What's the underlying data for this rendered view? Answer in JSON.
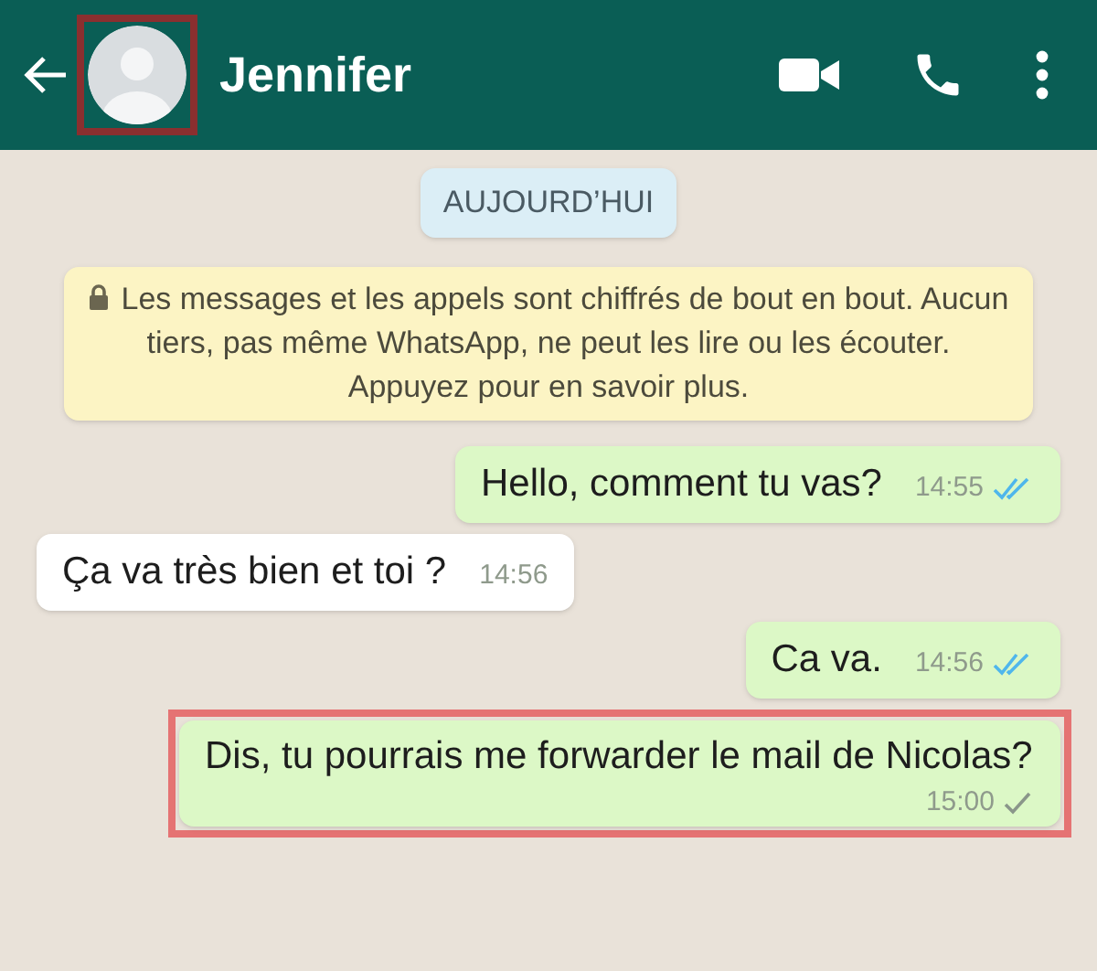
{
  "header": {
    "contact_name": "Jennifer",
    "avatar_highlighted": true
  },
  "date_chip": "AUJOURD’HUI",
  "notice": "Les messages et les appels sont chiffrés de bout en bout. Aucun tiers, pas même WhatsApp, ne peut les lire ou les écouter. Appuyez pour en savoir plus.",
  "messages": [
    {
      "outgoing": true,
      "text": "Hello, comment tu vas?",
      "time": "14:55",
      "read": true,
      "highlighted": false
    },
    {
      "outgoing": false,
      "text": "Ça va très bien et toi ?",
      "time": "14:56",
      "highlighted": false
    },
    {
      "outgoing": true,
      "text": "Ca va.",
      "time": "14:56",
      "read": true,
      "highlighted": false
    },
    {
      "outgoing": true,
      "text": "Dis, tu pourrais me forwarder le mail de Nicolas?",
      "time": "15:00",
      "read": false,
      "highlighted": true
    }
  ]
}
